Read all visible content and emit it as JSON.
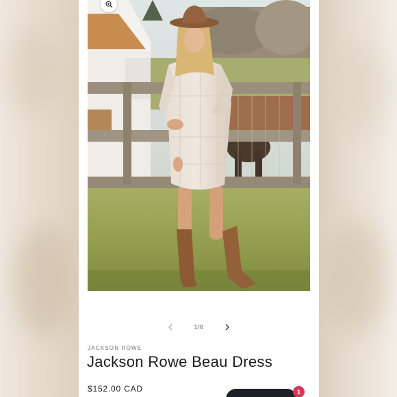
{
  "gallery": {
    "counter": "1/6",
    "prev_icon": "chevron-left-icon",
    "next_icon": "chevron-right-icon",
    "zoom_icon": "zoom-in-icon"
  },
  "product": {
    "vendor": "JACKSON ROWE",
    "title": "Jackson Rowe Beau Dress",
    "price": "$152.00 CAD"
  },
  "chat": {
    "badge_count": "1"
  },
  "colors": {
    "accent_badge": "#d6385a",
    "chat_button": "#1f1f28",
    "text": "#1d1d1d"
  }
}
